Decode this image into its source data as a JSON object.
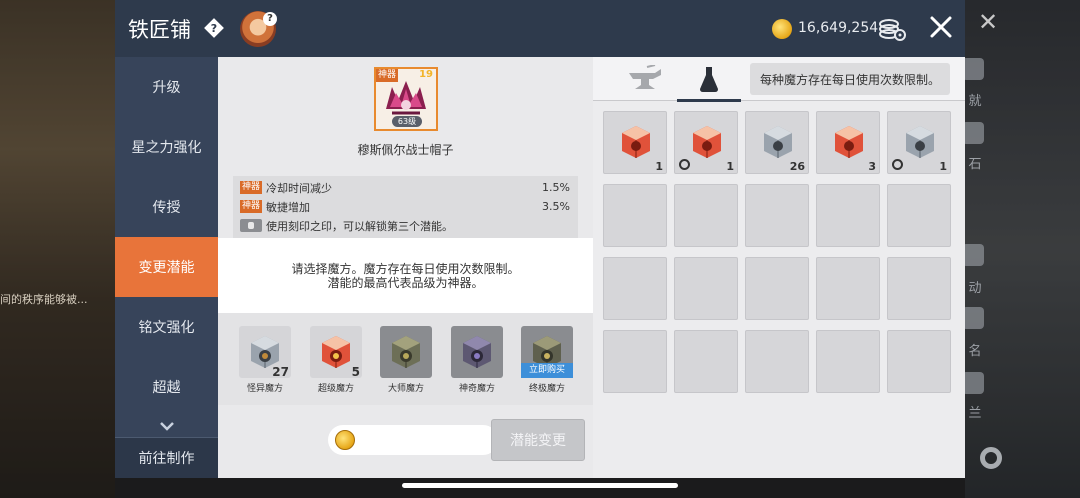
{
  "window": {
    "title": "铁匠铺",
    "meso_amount": "16,649,254"
  },
  "nav": {
    "items": [
      {
        "label": "升级",
        "active": false
      },
      {
        "label": "星之力强化",
        "active": false
      },
      {
        "label": "传授",
        "active": false
      },
      {
        "label": "变更潜能",
        "active": true
      },
      {
        "label": "铭文强化",
        "active": false
      },
      {
        "label": "超越",
        "active": false
      }
    ],
    "footer_label": "前往制作"
  },
  "item": {
    "tag": "神器",
    "upgrade_level": "19",
    "level": "63级",
    "name": "穆斯佩尔战士帽子"
  },
  "potentials": [
    {
      "tag": "神器",
      "text": "冷却时间减少",
      "value": "1.5%"
    },
    {
      "tag": "神器",
      "text": "敏捷增加",
      "value": "3.5%"
    },
    {
      "tag": "",
      "text": "使用刻印之印，可以解锁第三个潜能。",
      "value": ""
    }
  ],
  "notice": {
    "line1": "请选择魔方。魔方存在每日使用次数限制。",
    "line2": "潜能的最高代表品级为神器。"
  },
  "cubes": [
    {
      "name": "怪异魔方",
      "count": "27",
      "color": "silver",
      "owned": true
    },
    {
      "name": "超级魔方",
      "count": "5",
      "color": "red",
      "owned": true
    },
    {
      "name": "大师魔方",
      "count": "",
      "color": "gold",
      "owned": false
    },
    {
      "name": "神奇魔方",
      "count": "",
      "color": "purple",
      "owned": false
    },
    {
      "name": "终极魔方",
      "count": "",
      "color": "gold",
      "owned": false,
      "buy_label": "立即购买"
    }
  ],
  "change_button_label": "潜能变更",
  "inventory": {
    "note": "每种魔方存在每日使用次数限制。",
    "tabs": [
      "anvil-icon",
      "potion-icon"
    ],
    "active_tab": 1,
    "items": [
      {
        "color": "red",
        "count": "1",
        "timed": false
      },
      {
        "color": "red",
        "count": "1",
        "timed": true
      },
      {
        "color": "silver",
        "count": "26",
        "timed": false
      },
      {
        "color": "red",
        "count": "3",
        "timed": false
      },
      {
        "color": "silver",
        "count": "1",
        "timed": true
      }
    ],
    "total_slots": 20
  },
  "colors": {
    "header": "#2e3a4c",
    "nav": "#37445a",
    "active": "#e8743a",
    "tag": "#d96b28"
  }
}
